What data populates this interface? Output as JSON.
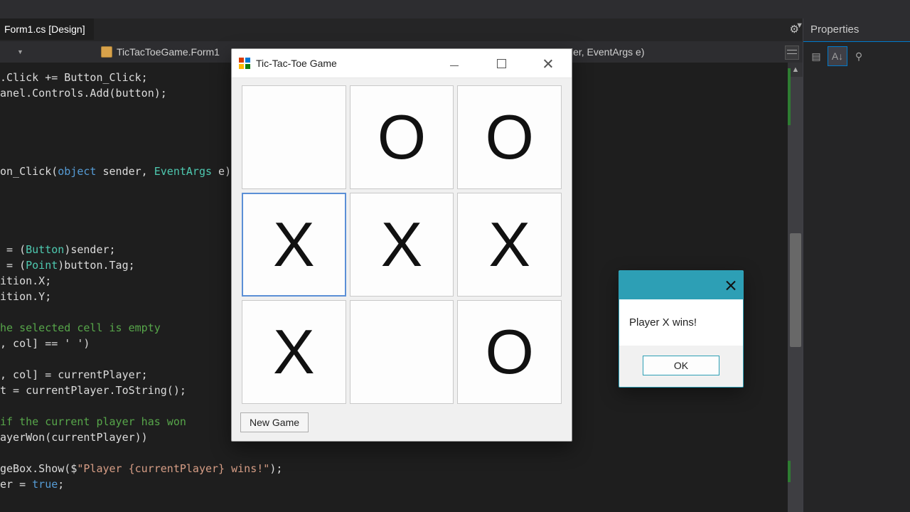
{
  "ide": {
    "active_tab": "Form1.cs [Design]",
    "nav_left": "",
    "nav_class": "TicTacToeGame.Form1",
    "nav_member": "Button_Click(object sender, EventArgs e)",
    "properties_title": "Properties"
  },
  "code": {
    "lines": [
      ".Click += Button_Click;",
      "anel.Controls.Add(button);",
      "",
      "",
      "",
      "",
      "on_Click(object sender, EventArgs e)",
      "",
      "",
      "",
      "",
      " = (Button)sender;",
      " = (Point)button.Tag;",
      "ition.X;",
      "ition.Y;",
      "",
      "he selected cell is empty",
      ", col] == ' ')",
      "",
      ", col] = currentPlayer;",
      "t = currentPlayer.ToString();",
      "",
      "if the current player has won",
      "ayerWon(currentPlayer))",
      "",
      "geBox.Show($\"Player {currentPlayer} wins!\");",
      "er = true;"
    ]
  },
  "game": {
    "title": "Tic-Tac-Toe Game",
    "new_game_label": "New Game",
    "board": [
      "",
      "O",
      "O",
      "X",
      "X",
      "X",
      "X",
      "",
      "O"
    ],
    "highlight_index": 3
  },
  "msgbox": {
    "message": "Player X wins!",
    "ok_label": "OK"
  }
}
